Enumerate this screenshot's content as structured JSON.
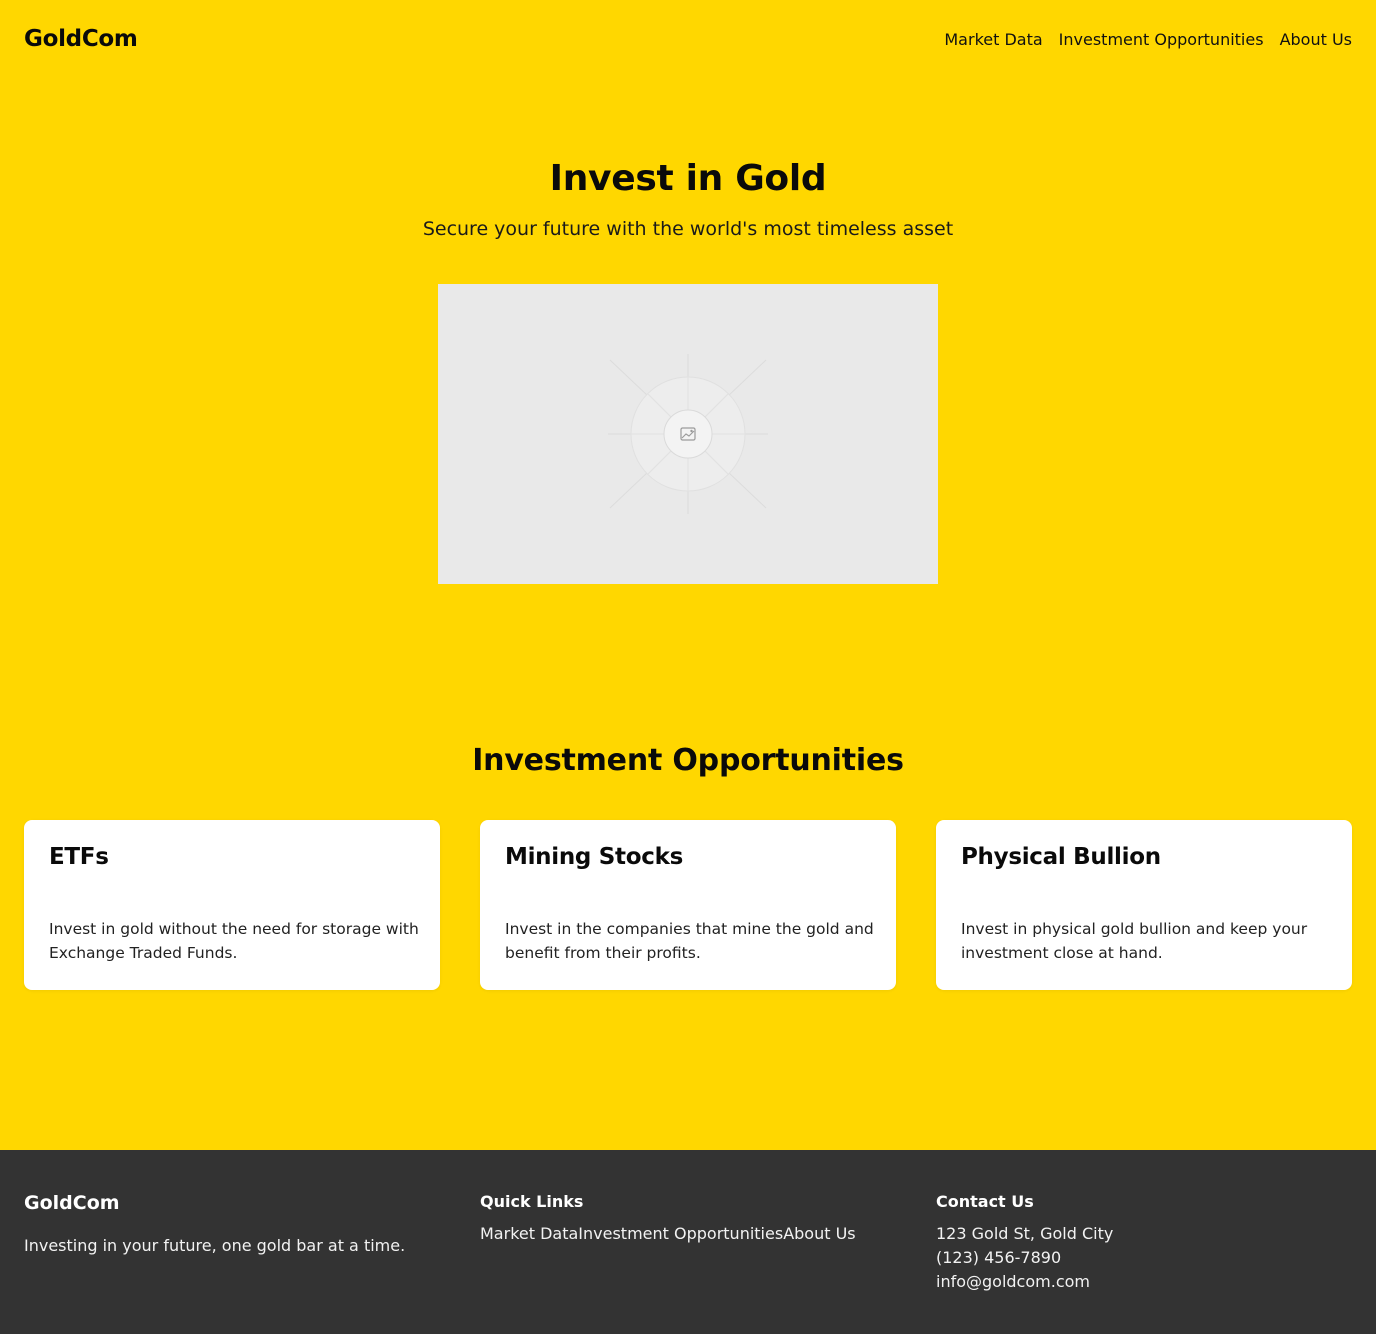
{
  "header": {
    "logo": "GoldCom",
    "nav": [
      "Market Data",
      "Investment Opportunities",
      "About Us"
    ]
  },
  "hero": {
    "title": "Invest in Gold",
    "subtitle": "Secure your future with the world's most timeless asset",
    "image_icon": "image-placeholder-icon"
  },
  "opportunities": {
    "title": "Investment Opportunities",
    "cards": [
      {
        "title": "ETFs",
        "text": "Invest in gold without the need for storage with Exchange Traded Funds."
      },
      {
        "title": "Mining Stocks",
        "text": "Invest in the companies that mine the gold and benefit from their profits."
      },
      {
        "title": "Physical Bullion",
        "text": "Invest in physical gold bullion and keep your investment close at hand."
      }
    ]
  },
  "footer": {
    "brand": "GoldCom",
    "tagline": "Investing in your future, one gold bar at a time.",
    "quick_links_title": "Quick Links",
    "quick_links": [
      "Market Data",
      "Investment Opportunities",
      "About Us"
    ],
    "contact_title": "Contact Us",
    "address": "123 Gold St, Gold City",
    "phone": "(123) 456-7890",
    "email": "info@goldcom.com"
  },
  "colors": {
    "background": "#FFD700",
    "footer": "#333333",
    "card": "#FFFFFF",
    "image_placeholder": "#E9E9E9"
  }
}
